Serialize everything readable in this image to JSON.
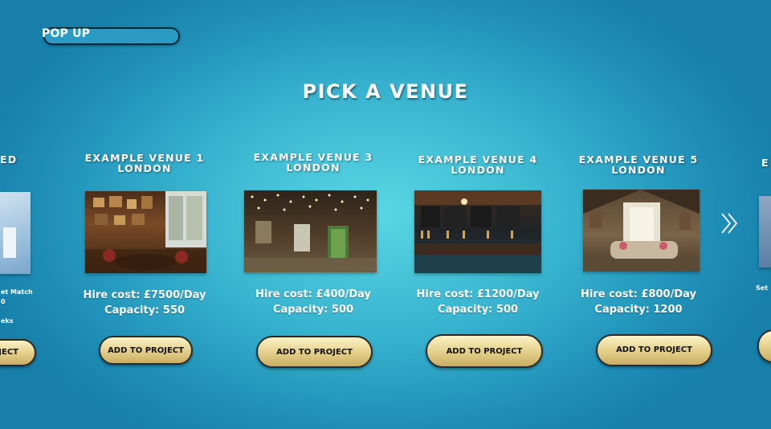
{
  "popup": {
    "label": "POP UP"
  },
  "page_title": "PICK A VENUE",
  "left_partial": {
    "title": "ED",
    "line1": "et Match",
    "line2": "0",
    "line3": "eks",
    "button": "OJECT"
  },
  "venues": [
    {
      "line1": "EXAMPLE VENUE 1",
      "line2": "LONDON",
      "hire": "Hire cost: £7500/Day",
      "capacity": "Capacity: 550",
      "button": "ADD TO PROJECT"
    },
    {
      "line1": "EXAMPLE VENUE 3",
      "line2": "LONDON",
      "hire": "Hire cost: £400/Day",
      "capacity": "Capacity: 500",
      "button": "ADD TO PROJECT"
    },
    {
      "line1": "EXAMPLE VENUE 4",
      "line2": "LONDON",
      "hire": "Hire cost: £1200/Day",
      "capacity": "Capacity: 500",
      "button": "ADD TO PROJECT"
    },
    {
      "line1": "EXAMPLE VENUE 5",
      "line2": "LONDON",
      "hire": "Hire cost: £800/Day",
      "capacity": "Capacity: 1200",
      "button": "ADD TO PROJECT"
    }
  ],
  "right_partial": {
    "title": "E",
    "line1": "Set"
  },
  "icons": {
    "next": "double-chevron-right-icon"
  },
  "colors": {
    "button_gold": "#e8d592",
    "background": "#38b4d0"
  }
}
